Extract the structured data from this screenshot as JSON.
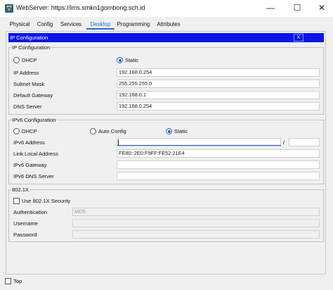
{
  "window": {
    "title": "WebServer: https://lms.smkn1gombong.sch.id",
    "minimize_glyph": "—",
    "maximize_glyph": "☐",
    "close_glyph": "✕"
  },
  "tabs": [
    {
      "label": "Physical"
    },
    {
      "label": "Config"
    },
    {
      "label": "Services"
    },
    {
      "label": "Desktop",
      "active": true
    },
    {
      "label": "Programming"
    },
    {
      "label": "Attributes"
    }
  ],
  "ip_configuration": {
    "bar_title": "IP Configuration",
    "close_label": "X",
    "group_title": "IP Configuration",
    "dhcp_label": "DHCP",
    "static_label": "Static",
    "mode": "Static",
    "fields": {
      "ip_address": {
        "label": "IP Address",
        "value": "192.168.0.254"
      },
      "subnet_mask": {
        "label": "Subnet Mask",
        "value": "255.255.255.0"
      },
      "default_gateway": {
        "label": "Default Gateway",
        "value": "192.168.0.1"
      },
      "dns_server": {
        "label": "DNS Server",
        "value": "192.168.0.254"
      }
    }
  },
  "ipv6_configuration": {
    "group_title": "IPv6 Configuration",
    "dhcp_label": "DHCP",
    "auto_config_label": "Auto Config",
    "static_label": "Static",
    "mode": "Static",
    "slash": "/",
    "fields": {
      "ipv6_address": {
        "label": "IPv6 Address",
        "value": "",
        "prefix": ""
      },
      "link_local_address": {
        "label": "Link Local Address",
        "value": "FE80::2E0:F9FF:FE52:21E4"
      },
      "ipv6_gateway": {
        "label": "IPv6 Gateway",
        "value": ""
      },
      "ipv6_dns_server": {
        "label": "IPv6 DNS Server",
        "value": ""
      }
    }
  },
  "dot1x": {
    "group_title": "802.1X",
    "use_security_label": "Use 802.1X Security",
    "use_security_checked": false,
    "authentication_label": "Authentication",
    "authentication_value": "MD5",
    "username_label": "Username",
    "username_value": "",
    "password_label": "Password",
    "password_value": ""
  },
  "footer": {
    "top_label": "Top",
    "top_checked": false
  },
  "colors": {
    "header_bar": "#0a16e8",
    "active_tab": "#1e6fcf",
    "radio_selected": "#1e5fc8"
  },
  "icons": {
    "app": "packet-tracer-app-icon"
  }
}
